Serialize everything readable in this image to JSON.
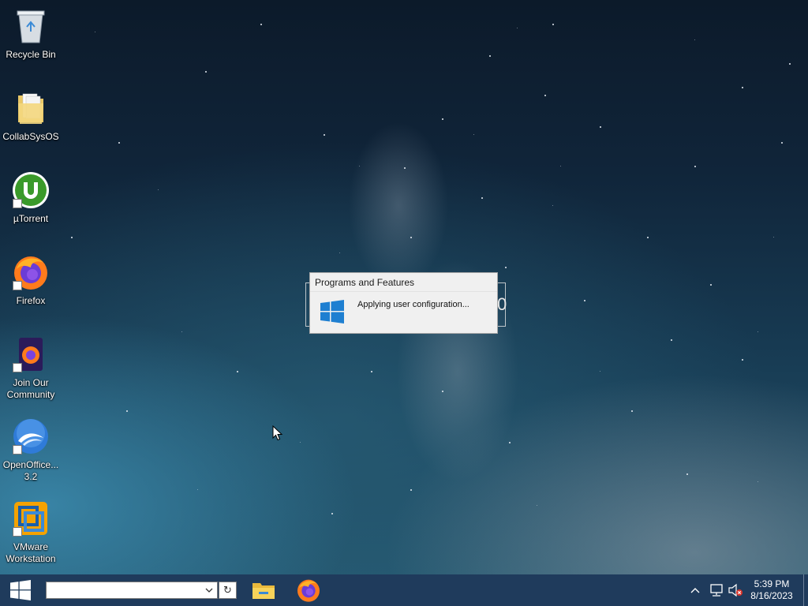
{
  "desktop": {
    "icons": [
      {
        "label": "Recycle Bin",
        "icon": "recycle-bin-icon",
        "shortcut": false
      },
      {
        "label": "CollabSysOS",
        "icon": "folder-icon",
        "shortcut": false
      },
      {
        "label": "µTorrent",
        "icon": "utorrent-icon",
        "shortcut": true
      },
      {
        "label": "Firefox",
        "icon": "firefox-icon",
        "shortcut": true
      },
      {
        "label": "Join Our Community",
        "icon": "firefox-document-icon",
        "shortcut": true
      },
      {
        "label": "OpenOffice... 3.2",
        "icon": "openoffice-icon",
        "shortcut": true
      },
      {
        "label": "VMware Workstation",
        "icon": "vmware-icon",
        "shortcut": true
      }
    ]
  },
  "dialog": {
    "title": "Programs and Features",
    "message": "Applying user configuration...",
    "behind_digit": "0"
  },
  "taskbar": {
    "search_value": "",
    "refresh_glyph": "↻",
    "pinned": [
      {
        "name": "file-explorer",
        "icon": "folder-icon"
      },
      {
        "name": "firefox",
        "icon": "firefox-icon"
      }
    ],
    "clock": {
      "time": "5:39 PM",
      "date": "8/16/2023"
    }
  },
  "colors": {
    "taskbar": "#1f3b5c",
    "windows_blue": "#1e7fd1",
    "utorrent_green": "#3a9a2a",
    "firefox_orange": "#ff7b1c"
  }
}
